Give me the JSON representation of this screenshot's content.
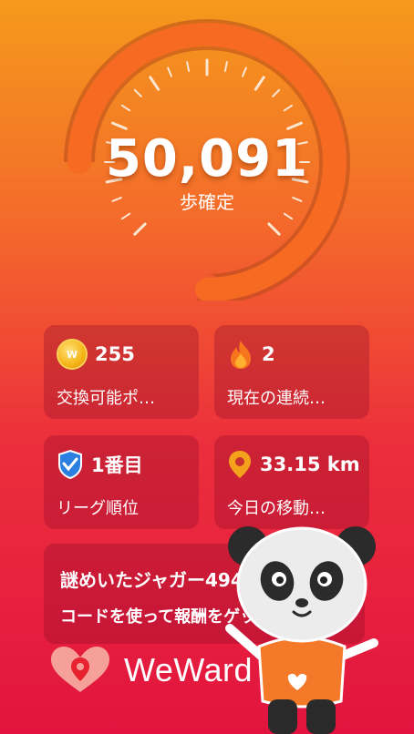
{
  "gauge": {
    "steps_value": "50,091",
    "steps_unit": "歩確定"
  },
  "stats": [
    {
      "value": "255",
      "label": "交換可能ポ…",
      "icon": "coin-icon"
    },
    {
      "value": "2",
      "label": "現在の連続…",
      "icon": "flame-icon"
    },
    {
      "value": "1番目",
      "label": "リーグ順位",
      "icon": "league-shield-icon"
    },
    {
      "value": "33.15 km",
      "label": "今日の移動…",
      "icon": "location-pin-icon"
    }
  ],
  "coin_symbol": "W",
  "promo": {
    "line1": "謎めいたジャガー4940",
    "line2": "コードを使って報酬をゲット"
  },
  "brand": {
    "name": "WeWard"
  },
  "colors": {
    "accent_orange": "#f66b21",
    "background_top": "#f59a1b",
    "background_bottom": "#e2143f"
  }
}
